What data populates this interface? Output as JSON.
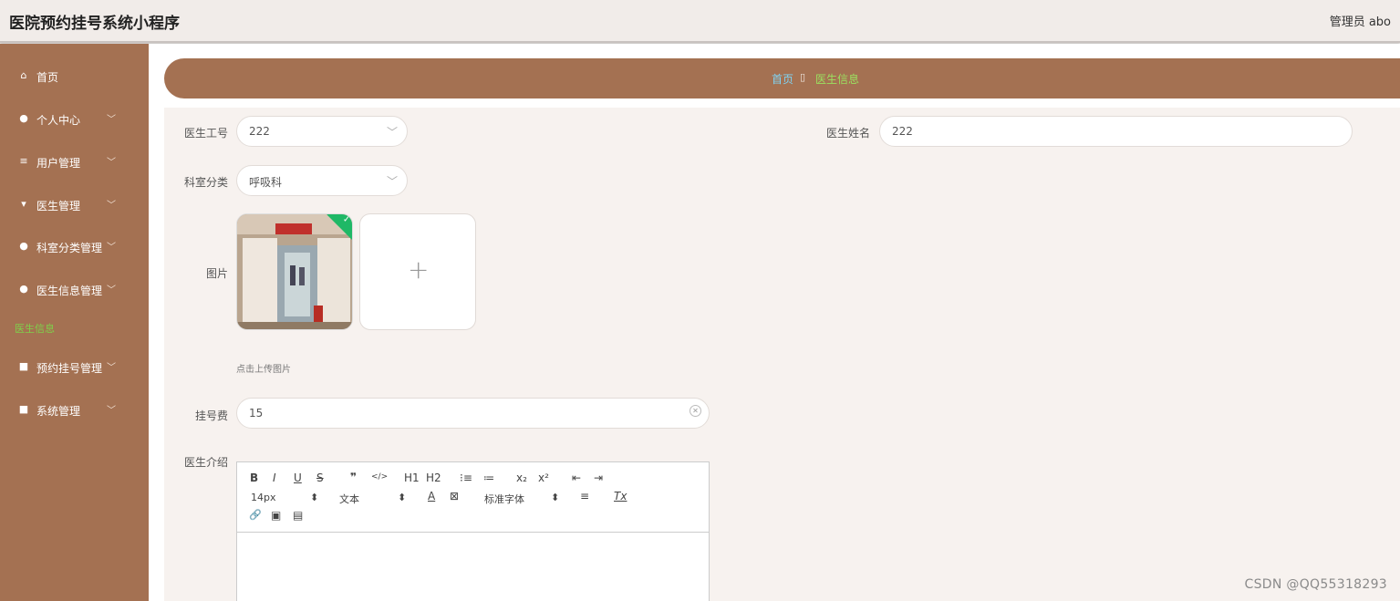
{
  "header": {
    "app_title": "医院预约挂号系统小程序",
    "user_label": "管理员 abo"
  },
  "sidebar": {
    "items": [
      {
        "label": "首页",
        "icon": "home-icon",
        "glyph": "⌂",
        "has_arrow": false
      },
      {
        "label": "个人中心",
        "icon": "user-icon",
        "glyph": "●",
        "has_arrow": true
      },
      {
        "label": "用户管理",
        "icon": "list-icon",
        "glyph": "≡",
        "has_arrow": true
      },
      {
        "label": "医生管理",
        "icon": "doctor-icon",
        "glyph": "▾",
        "has_arrow": true
      },
      {
        "label": "科室分类管理",
        "icon": "user-icon",
        "glyph": "●",
        "has_arrow": true
      },
      {
        "label": "医生信息管理",
        "icon": "user-icon",
        "glyph": "●",
        "has_arrow": true
      },
      {
        "label": "预约挂号管理",
        "icon": "grid-icon",
        "glyph": "■",
        "has_arrow": true
      },
      {
        "label": "系统管理",
        "icon": "grid-icon",
        "glyph": "■",
        "has_arrow": true
      }
    ],
    "active_sub_item": "医生信息",
    "arrow_glyph": "﹀"
  },
  "breadcrumb": {
    "home": "首页",
    "separator": "▯",
    "current": "医生信息"
  },
  "form": {
    "doctor_id": {
      "label": "医生工号",
      "value": "222"
    },
    "doctor_name": {
      "label": "医生姓名",
      "value": "222"
    },
    "department": {
      "label": "科室分类",
      "value": "呼吸科"
    },
    "picture": {
      "label": "图片",
      "hint": "点击上传图片",
      "plus": "+"
    },
    "fee": {
      "label": "挂号费",
      "value": "15"
    },
    "intro": {
      "label": "医生介绍"
    }
  },
  "editor": {
    "row1": [
      "B",
      "I",
      "U",
      "S",
      "❞",
      "</>",
      "H1",
      "H2",
      "⁝≡",
      "≔",
      "x₂",
      "x²",
      "⇤",
      "⇥"
    ],
    "font_size": "14px",
    "text_style": "文本",
    "font_family": "标准字体",
    "select_arrow": "⬍",
    "row2_icons": [
      "A",
      "⊠",
      "≡",
      "Tx"
    ],
    "row3": [
      "🔗",
      "▣",
      "▤"
    ]
  },
  "watermark": "CSDN @QQ55318293",
  "colors": {
    "sidebar": "#a47152",
    "breadcrumb_bar": "#a47152",
    "active_green": "#7fd04a",
    "link_blue": "#7fd3f3",
    "check_green": "#1fb866"
  }
}
